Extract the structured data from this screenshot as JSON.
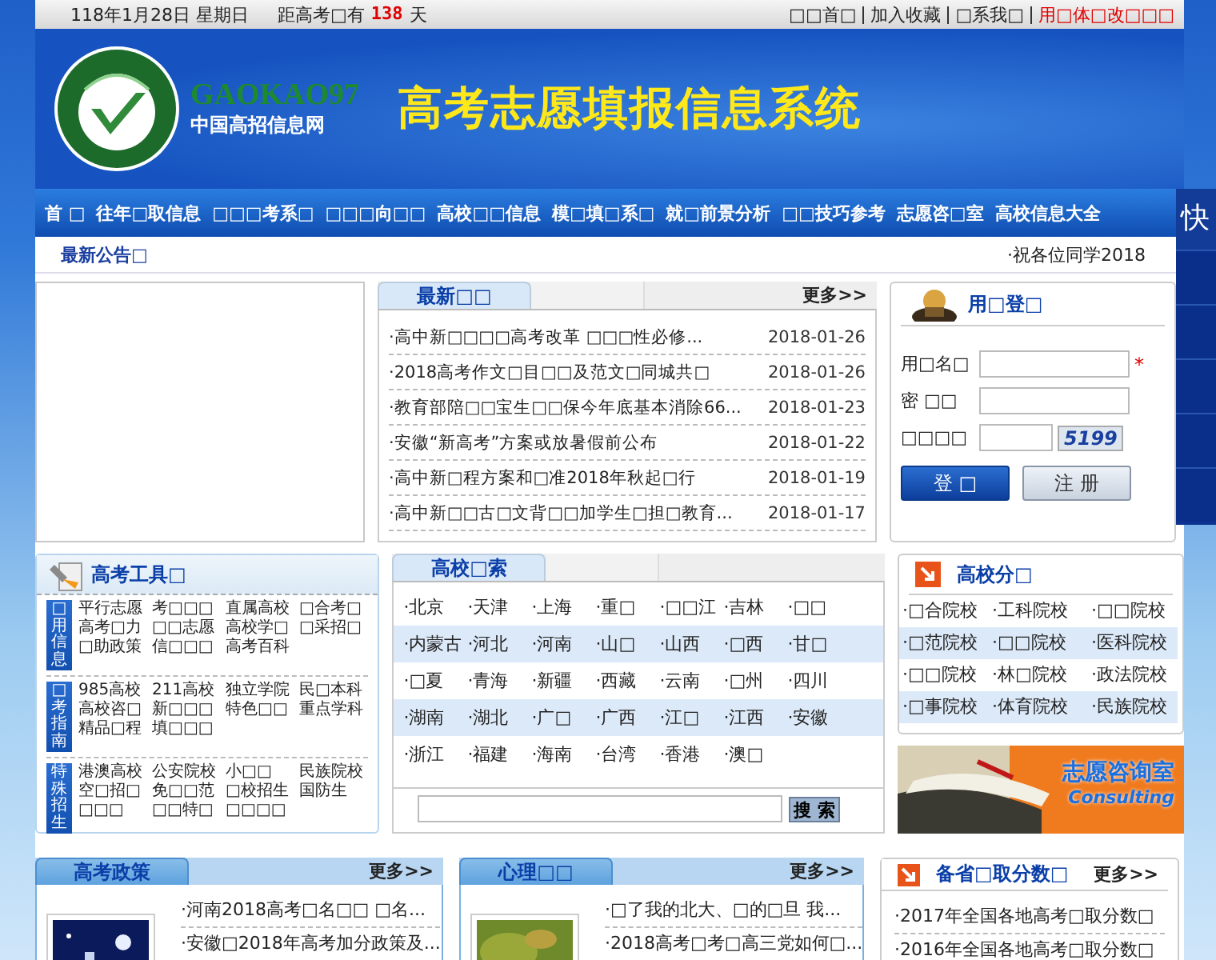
{
  "top_bar": {
    "date": "118年1月28日 星期日",
    "countdown_prefix": "距高考□有",
    "countdown_days": "138",
    "countdown_suffix": "天",
    "links": [
      {
        "label": "□□首□",
        "highlight": false
      },
      {
        "label": "加入收藏",
        "highlight": false
      },
      {
        "label": "□系我□",
        "highlight": false
      },
      {
        "label": "用□体□改□□□",
        "highlight": true
      }
    ]
  },
  "header": {
    "logo_text": "GAOKAO97",
    "logo_subtitle": "中国高招信息网",
    "title": "高考志愿填报信息系统"
  },
  "nav": [
    "首 □",
    "往年□取信息",
    "□□□考系□",
    "□□□向□□",
    "高校□□信息",
    "模□填□系□",
    "就□前景分析",
    "□□技巧参考",
    "志愿咨□室",
    "高校信息大全"
  ],
  "side_strip": {
    "label": "快"
  },
  "notice": {
    "title": "最新公告□",
    "text": "·祝各位同学2018"
  },
  "news": {
    "tab": "最新□□",
    "more": "更多>>",
    "items": [
      {
        "title": "·高中新□□□□高考改革 □□□性必修...",
        "date": "2018-01-26"
      },
      {
        "title": "·2018高考作文□目□□及范文□同城共□",
        "date": "2018-01-26"
      },
      {
        "title": "·教育部陪□□宝生□□保今年底基本消除66...",
        "date": "2018-01-23"
      },
      {
        "title": "·安徽“新高考”方案或放暑假前公布",
        "date": "2018-01-22"
      },
      {
        "title": "·高中新□程方案和□准2018年秋起□行",
        "date": "2018-01-19"
      },
      {
        "title": "·高中新□□古□文背□□加学生□担□教育...",
        "date": "2018-01-17"
      }
    ]
  },
  "login": {
    "title": "用□登□",
    "required_mark": "*",
    "fields": [
      {
        "label": "用□名□",
        "required": true
      },
      {
        "label": "密 □□",
        "required": false
      },
      {
        "label": "□□□□",
        "required": false,
        "captcha": "5199"
      }
    ],
    "buttons": [
      {
        "label": "登 □",
        "kind": "primary"
      },
      {
        "label": "注 册",
        "kind": "secondary"
      }
    ]
  },
  "tools": {
    "title": "高考工具□",
    "groups": [
      {
        "label": "□用信息",
        "items": [
          "平行志愿",
          "考□□□",
          "直属高校",
          "□合考□",
          "高考□力",
          "□□志愿",
          "高校学□",
          "□采招□",
          "□助政策",
          "信□□□",
          "高考百科"
        ]
      },
      {
        "label": "□考指南",
        "items": [
          "985高校",
          "211高校",
          "独立学院",
          "民□本科",
          "高校咨□",
          "新□□□",
          "特色□□",
          "重点学科",
          "精品□程",
          "填□□□"
        ]
      },
      {
        "label": "特殊招生",
        "items": [
          "港澳高校",
          "公安院校",
          "小□□",
          "民族院校",
          "空□招□",
          "免□□范",
          "□校招生",
          "国防生",
          "□□□",
          "□□特□",
          "□□□□"
        ]
      }
    ]
  },
  "school_search": {
    "tab": "高校□索",
    "rows": [
      [
        "·北京",
        "·天津",
        "·上海",
        "·重□",
        "·□□江",
        "·吉林",
        "·□□"
      ],
      [
        "·内蒙古",
        "·河北",
        "·河南",
        "·山□",
        "·山西",
        "·□西",
        "·甘□"
      ],
      [
        "·□夏",
        "·青海",
        "·新疆",
        "·西藏",
        "·云南",
        "·□州",
        "·四川"
      ],
      [
        "·湖南",
        "·湖北",
        "·广□",
        "·广西",
        "·江□",
        "·江西",
        "·安徽"
      ],
      [
        "·浙江",
        "·福建",
        "·海南",
        "·台湾",
        "·香港",
        "·澳□"
      ]
    ],
    "button": "搜 索"
  },
  "school_types": {
    "title": "高校分□",
    "items": [
      "·□合院校",
      "·工科院校",
      "·□□院校",
      "·□范院校",
      "·□□院校",
      "·医科院校",
      "·□□院校",
      "·林□院校",
      "·政法院校",
      "·□事院校",
      "·体育院校",
      "·民族院校"
    ]
  },
  "consult_banner": {
    "title": "志愿咨询室",
    "subtitle": "Consulting"
  },
  "bottom_panels": [
    {
      "kind": "tabbed",
      "tab": "高考政策",
      "more": "更多>>",
      "items": [
        "·河南2018高考□名□□ □名...",
        "·安徽□2018年高考加分政策及..."
      ]
    },
    {
      "kind": "tabbed",
      "tab": "心理□□",
      "more": "更多>>",
      "items": [
        "·□了我的北大、□的□旦 我...",
        "·2018高考□考□高三党如何□..."
      ]
    },
    {
      "kind": "titled",
      "tab": "备省□取分数□",
      "more": "更多>>",
      "items": [
        "·2017年全国各地高考□取分数□",
        "·2016年全国各地高考□取分数□"
      ]
    }
  ]
}
